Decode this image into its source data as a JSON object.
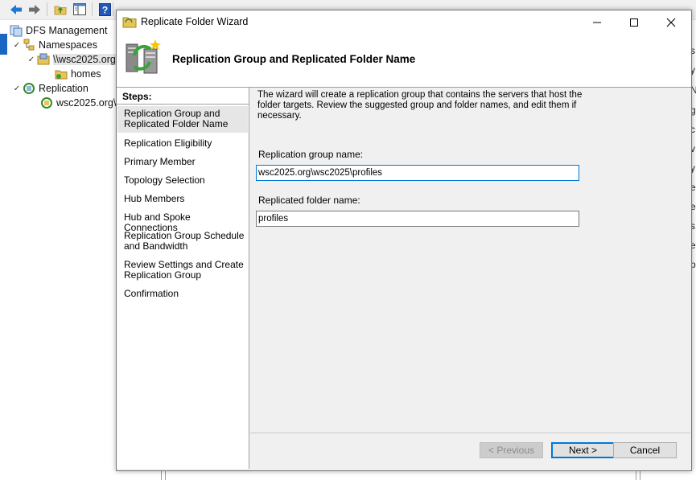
{
  "background": {
    "tree": {
      "root": "DFS Management",
      "namespaces": "Namespaces",
      "namespace_item": "\\\\wsc2025.org",
      "homes": "homes",
      "replication": "Replication",
      "replication_item": "wsc2025.org\\"
    },
    "right_fragments": [
      "s",
      "y",
      "N",
      "g",
      "c",
      "v",
      "y",
      "e",
      "e",
      "s",
      "e",
      "p"
    ]
  },
  "wizard": {
    "title": "Replicate Folder Wizard",
    "page_title": "Replication Group and Replicated Folder Name",
    "steps_label": "Steps:",
    "steps": [
      "Replication Group and Replicated Folder Name",
      "Replication Eligibility",
      "Primary Member",
      "Topology Selection",
      "Hub Members",
      "Hub and Spoke Connections",
      "Replication Group Schedule and Bandwidth",
      "Review Settings and Create Replication Group",
      "Confirmation"
    ],
    "description": "The wizard will create a replication group that contains the servers that host the folder targets. Review the suggested group and folder names, and edit them if necessary.",
    "group_name_label": "Replication group name:",
    "group_name_value": "wsc2025.org\\wsc2025\\profiles",
    "folder_name_label": "Replicated folder name:",
    "folder_name_value": "profiles",
    "buttons": {
      "previous": "< Previous",
      "next": "Next >",
      "cancel": "Cancel"
    }
  },
  "colors": {
    "accent": "#0078d7",
    "dialog_bg": "#f0f0f0",
    "selected_step": "#e6e6e6"
  }
}
